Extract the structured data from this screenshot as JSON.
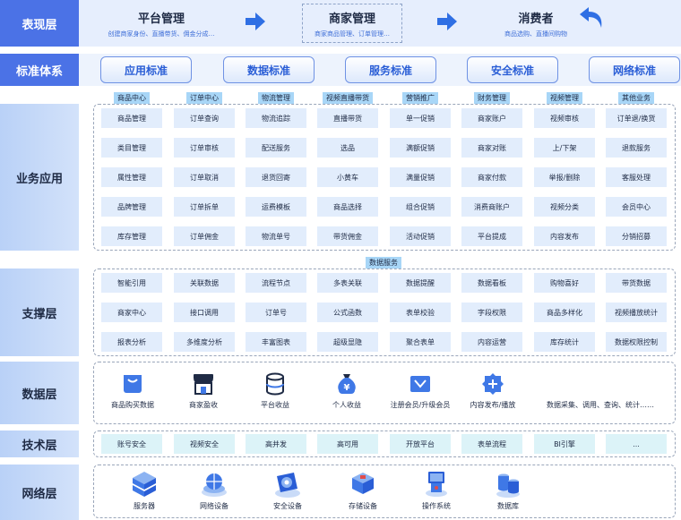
{
  "layers": {
    "presentation": "表现层",
    "standards": "标准体系",
    "business": "业务应用",
    "support": "支撑层",
    "data": "数据层",
    "tech": "技术层",
    "network": "网络层"
  },
  "presentation": {
    "platform": {
      "title": "平台管理",
      "sub": "创建商家身份、直播带货、佣金分成…"
    },
    "merchant": {
      "title": "商家管理",
      "sub": "商家商品管理、订单管理…"
    },
    "consumer": {
      "title": "消费者",
      "sub": "商品选购、直播间购物"
    }
  },
  "standards": [
    "应用标准",
    "数据标准",
    "服务标准",
    "安全标准",
    "网络标准"
  ],
  "business": {
    "categories": [
      "商品中心",
      "订单中心",
      "物流管理",
      "视频直播带货",
      "营销推广",
      "财务管理",
      "视频管理",
      "其他业务"
    ],
    "rows": [
      [
        "商品管理",
        "订单查询",
        "物流追踪",
        "直播带货",
        "单一促销",
        "商家账户",
        "视频审核",
        "订单退/换货"
      ],
      [
        "类目管理",
        "订单审核",
        "配送服务",
        "选品",
        "满额促销",
        "商家对账",
        "上/下架",
        "退款服务"
      ],
      [
        "属性管理",
        "订单取消",
        "退货回寄",
        "小黄车",
        "满量促销",
        "商家付款",
        "举报/删除",
        "客服处理"
      ],
      [
        "品牌管理",
        "订单拆单",
        "运费模板",
        "商品选择",
        "组合促销",
        "消费商账户",
        "视频分类",
        "会员中心"
      ],
      [
        "库存管理",
        "订单佣金",
        "物流单号",
        "带货佣金",
        "活动促销",
        "平台提成",
        "内容发布",
        "分销招募"
      ]
    ]
  },
  "support": {
    "tag": "数据服务",
    "rows": [
      [
        "智能引用",
        "关联数据",
        "流程节点",
        "多表关联",
        "数据提醒",
        "数据看板",
        "购物喜好",
        "带货数据"
      ],
      [
        "商家中心",
        "接口调用",
        "订单号",
        "公式函数",
        "表单校验",
        "字段权限",
        "商品多样化",
        "视频播放统计"
      ],
      [
        "报表分析",
        "多维度分析",
        "丰富图表",
        "超级显隐",
        "聚合表单",
        "内容运营",
        "库存统计",
        "数据权限控制"
      ]
    ]
  },
  "data_items": [
    {
      "label": "商品购买数据",
      "icon": "shopping-bag-icon"
    },
    {
      "label": "商家盈收",
      "icon": "store-icon"
    },
    {
      "label": "平台收益",
      "icon": "database-icon"
    },
    {
      "label": "个人收益",
      "icon": "money-bag-icon"
    },
    {
      "label": "注册会员/升级会员",
      "icon": "vip-card-icon"
    },
    {
      "label": "内容发布/播放",
      "icon": "content-publish-icon"
    },
    {
      "label": "数据采集、调用、查询、统计……",
      "icon": ""
    }
  ],
  "tech": [
    "账号安全",
    "视频安全",
    "高并发",
    "高可用",
    "开放平台",
    "表单流程",
    "BI引擎",
    "..."
  ],
  "network": [
    {
      "label": "服务器",
      "icon": "server-icon"
    },
    {
      "label": "网络设备",
      "icon": "network-device-icon"
    },
    {
      "label": "安全设备",
      "icon": "security-device-icon"
    },
    {
      "label": "存储设备",
      "icon": "storage-device-icon"
    },
    {
      "label": "操作系统",
      "icon": "operating-system-icon"
    },
    {
      "label": "数据库",
      "icon": "database-server-icon"
    }
  ],
  "colors": {
    "accent": "#4b72e6",
    "arrow": "#2f6fe4",
    "cell": "#e2edfc",
    "tech_cell": "#dcf3f8",
    "tag": "#a8d6f7"
  }
}
